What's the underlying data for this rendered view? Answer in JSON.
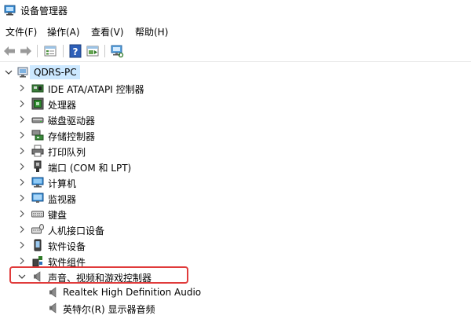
{
  "window": {
    "title": "设备管理器",
    "icon": "device-manager-icon"
  },
  "menu": [
    "文件(F)",
    "操作(A)",
    "查看(V)",
    "帮助(H)"
  ],
  "toolbar": {
    "buttons": [
      "back-arrow-icon",
      "forward-arrow-icon",
      "properties-icon",
      "help-icon",
      "update-driver-icon",
      "scan-hardware-icon"
    ]
  },
  "tree": {
    "root": {
      "label": "QDRS-PC",
      "icon": "computer-icon",
      "expanded": true,
      "selected": true
    },
    "categories": [
      {
        "label": "IDE ATA/ATAPI 控制器",
        "icon": "ide-controller-icon"
      },
      {
        "label": "处理器",
        "icon": "processor-icon"
      },
      {
        "label": "磁盘驱动器",
        "icon": "disk-drive-icon"
      },
      {
        "label": "存储控制器",
        "icon": "storage-controller-icon"
      },
      {
        "label": "打印队列",
        "icon": "printer-icon"
      },
      {
        "label": "端口 (COM 和 LPT)",
        "icon": "port-icon"
      },
      {
        "label": "计算机",
        "icon": "computer-icon"
      },
      {
        "label": "监视器",
        "icon": "monitor-icon"
      },
      {
        "label": "键盘",
        "icon": "keyboard-icon"
      },
      {
        "label": "人机接口设备",
        "icon": "hid-icon"
      },
      {
        "label": "软件设备",
        "icon": "software-device-icon"
      },
      {
        "label": "软件组件",
        "icon": "software-component-icon"
      },
      {
        "label": "声音、视频和游戏控制器",
        "icon": "speaker-icon",
        "expanded": true,
        "highlighted": true
      }
    ],
    "children": [
      {
        "label": "Realtek High Definition Audio",
        "icon": "speaker-icon"
      },
      {
        "label": "英特尔(R) 显示器音频",
        "icon": "speaker-icon"
      }
    ]
  },
  "colors": {
    "selection": "#cce8ff",
    "highlight_border": "#e03b3b"
  }
}
